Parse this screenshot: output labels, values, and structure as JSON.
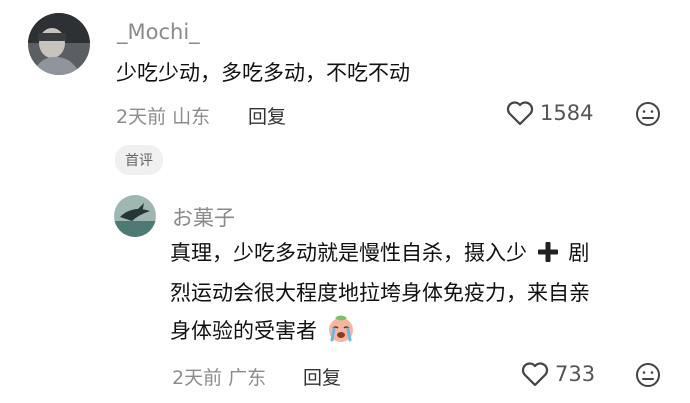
{
  "comment": {
    "username": "_Mochi_",
    "text": "少吃少动，多吃多动，不吃不动",
    "time": "2天前",
    "location": "山东",
    "reply_label": "回复",
    "likes": "1584",
    "badge": "首评"
  },
  "reply": {
    "username": "お菓子",
    "text_line1": "真理，少吃多动就是慢性自杀，摄入少",
    "text_line1b": "剧",
    "text_line2": "烈运动会很大程度地拉垮身体免疫力，来自亲",
    "text_line3": "身体验的受害者",
    "time": "2天前",
    "location": "广东",
    "reply_label": "回复",
    "likes": "733"
  },
  "icons": {
    "like": "heart-outline-icon",
    "dislike": "meh-face-icon",
    "plus": "heavy-plus-emoji",
    "crying": "crying-face-emoji"
  }
}
